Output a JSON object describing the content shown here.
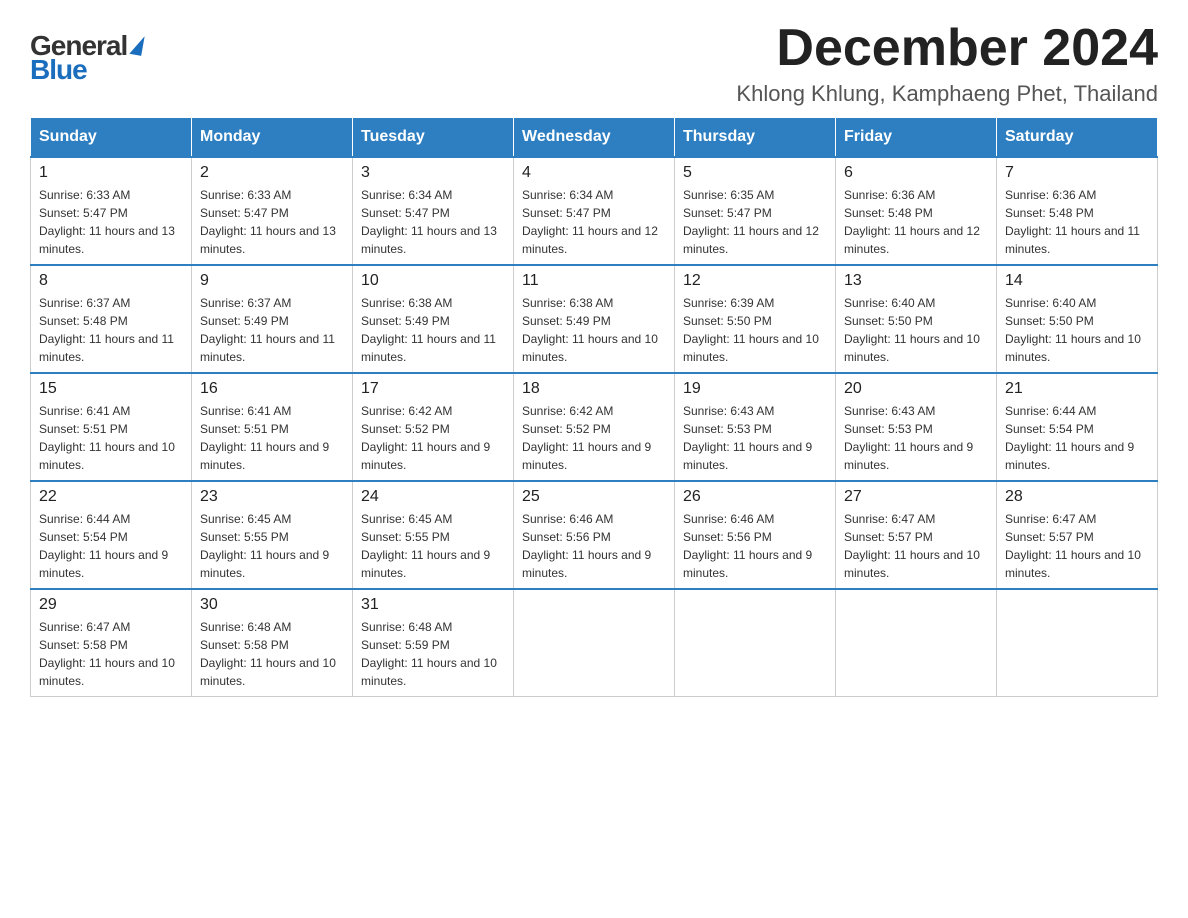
{
  "logo": {
    "general": "General",
    "blue": "Blue",
    "triangle": "▲"
  },
  "title": {
    "month_year": "December 2024",
    "location": "Khlong Khlung, Kamphaeng Phet, Thailand"
  },
  "header": {
    "days": [
      "Sunday",
      "Monday",
      "Tuesday",
      "Wednesday",
      "Thursday",
      "Friday",
      "Saturday"
    ]
  },
  "weeks": [
    [
      {
        "day": "1",
        "sunrise": "6:33 AM",
        "sunset": "5:47 PM",
        "daylight": "11 hours and 13 minutes."
      },
      {
        "day": "2",
        "sunrise": "6:33 AM",
        "sunset": "5:47 PM",
        "daylight": "11 hours and 13 minutes."
      },
      {
        "day": "3",
        "sunrise": "6:34 AM",
        "sunset": "5:47 PM",
        "daylight": "11 hours and 13 minutes."
      },
      {
        "day": "4",
        "sunrise": "6:34 AM",
        "sunset": "5:47 PM",
        "daylight": "11 hours and 12 minutes."
      },
      {
        "day": "5",
        "sunrise": "6:35 AM",
        "sunset": "5:47 PM",
        "daylight": "11 hours and 12 minutes."
      },
      {
        "day": "6",
        "sunrise": "6:36 AM",
        "sunset": "5:48 PM",
        "daylight": "11 hours and 12 minutes."
      },
      {
        "day": "7",
        "sunrise": "6:36 AM",
        "sunset": "5:48 PM",
        "daylight": "11 hours and 11 minutes."
      }
    ],
    [
      {
        "day": "8",
        "sunrise": "6:37 AM",
        "sunset": "5:48 PM",
        "daylight": "11 hours and 11 minutes."
      },
      {
        "day": "9",
        "sunrise": "6:37 AM",
        "sunset": "5:49 PM",
        "daylight": "11 hours and 11 minutes."
      },
      {
        "day": "10",
        "sunrise": "6:38 AM",
        "sunset": "5:49 PM",
        "daylight": "11 hours and 11 minutes."
      },
      {
        "day": "11",
        "sunrise": "6:38 AM",
        "sunset": "5:49 PM",
        "daylight": "11 hours and 10 minutes."
      },
      {
        "day": "12",
        "sunrise": "6:39 AM",
        "sunset": "5:50 PM",
        "daylight": "11 hours and 10 minutes."
      },
      {
        "day": "13",
        "sunrise": "6:40 AM",
        "sunset": "5:50 PM",
        "daylight": "11 hours and 10 minutes."
      },
      {
        "day": "14",
        "sunrise": "6:40 AM",
        "sunset": "5:50 PM",
        "daylight": "11 hours and 10 minutes."
      }
    ],
    [
      {
        "day": "15",
        "sunrise": "6:41 AM",
        "sunset": "5:51 PM",
        "daylight": "11 hours and 10 minutes."
      },
      {
        "day": "16",
        "sunrise": "6:41 AM",
        "sunset": "5:51 PM",
        "daylight": "11 hours and 9 minutes."
      },
      {
        "day": "17",
        "sunrise": "6:42 AM",
        "sunset": "5:52 PM",
        "daylight": "11 hours and 9 minutes."
      },
      {
        "day": "18",
        "sunrise": "6:42 AM",
        "sunset": "5:52 PM",
        "daylight": "11 hours and 9 minutes."
      },
      {
        "day": "19",
        "sunrise": "6:43 AM",
        "sunset": "5:53 PM",
        "daylight": "11 hours and 9 minutes."
      },
      {
        "day": "20",
        "sunrise": "6:43 AM",
        "sunset": "5:53 PM",
        "daylight": "11 hours and 9 minutes."
      },
      {
        "day": "21",
        "sunrise": "6:44 AM",
        "sunset": "5:54 PM",
        "daylight": "11 hours and 9 minutes."
      }
    ],
    [
      {
        "day": "22",
        "sunrise": "6:44 AM",
        "sunset": "5:54 PM",
        "daylight": "11 hours and 9 minutes."
      },
      {
        "day": "23",
        "sunrise": "6:45 AM",
        "sunset": "5:55 PM",
        "daylight": "11 hours and 9 minutes."
      },
      {
        "day": "24",
        "sunrise": "6:45 AM",
        "sunset": "5:55 PM",
        "daylight": "11 hours and 9 minutes."
      },
      {
        "day": "25",
        "sunrise": "6:46 AM",
        "sunset": "5:56 PM",
        "daylight": "11 hours and 9 minutes."
      },
      {
        "day": "26",
        "sunrise": "6:46 AM",
        "sunset": "5:56 PM",
        "daylight": "11 hours and 9 minutes."
      },
      {
        "day": "27",
        "sunrise": "6:47 AM",
        "sunset": "5:57 PM",
        "daylight": "11 hours and 10 minutes."
      },
      {
        "day": "28",
        "sunrise": "6:47 AM",
        "sunset": "5:57 PM",
        "daylight": "11 hours and 10 minutes."
      }
    ],
    [
      {
        "day": "29",
        "sunrise": "6:47 AM",
        "sunset": "5:58 PM",
        "daylight": "11 hours and 10 minutes."
      },
      {
        "day": "30",
        "sunrise": "6:48 AM",
        "sunset": "5:58 PM",
        "daylight": "11 hours and 10 minutes."
      },
      {
        "day": "31",
        "sunrise": "6:48 AM",
        "sunset": "5:59 PM",
        "daylight": "11 hours and 10 minutes."
      },
      null,
      null,
      null,
      null
    ]
  ]
}
